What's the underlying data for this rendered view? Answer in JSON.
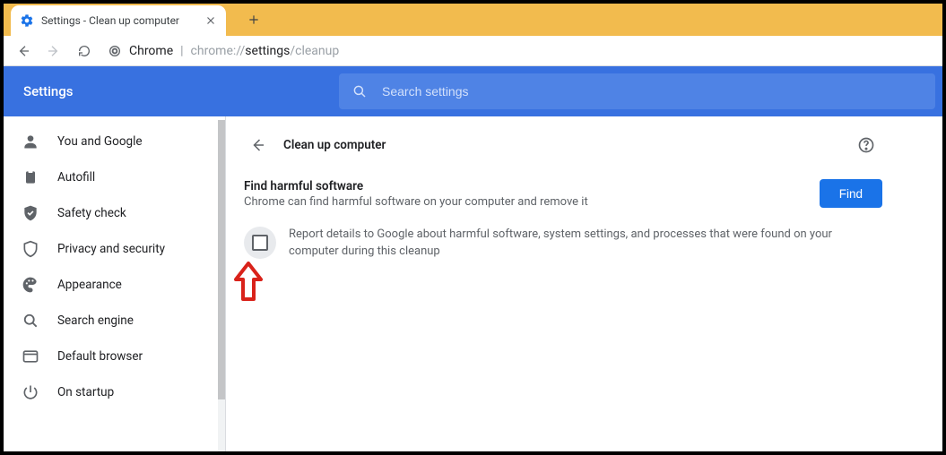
{
  "tab": {
    "title": "Settings - Clean up computer"
  },
  "url": {
    "host": "Chrome",
    "full": "chrome://settings/cleanup"
  },
  "header": {
    "brand": "Settings",
    "search_placeholder": "Search settings"
  },
  "sidebar": {
    "items": [
      {
        "label": "You and Google",
        "icon": "person"
      },
      {
        "label": "Autofill",
        "icon": "clipboard"
      },
      {
        "label": "Safety check",
        "icon": "shield-check"
      },
      {
        "label": "Privacy and security",
        "icon": "shield"
      },
      {
        "label": "Appearance",
        "icon": "palette"
      },
      {
        "label": "Search engine",
        "icon": "magnify"
      },
      {
        "label": "Default browser",
        "icon": "window"
      },
      {
        "label": "On startup",
        "icon": "power"
      }
    ]
  },
  "section": {
    "title": "Clean up computer",
    "panel_title": "Find harmful software",
    "panel_sub": "Chrome can find harmful software on your computer and remove it",
    "find_label": "Find",
    "checkbox_label": "Report details to Google about harmful software, system settings, and processes that were found on your computer during this cleanup"
  }
}
